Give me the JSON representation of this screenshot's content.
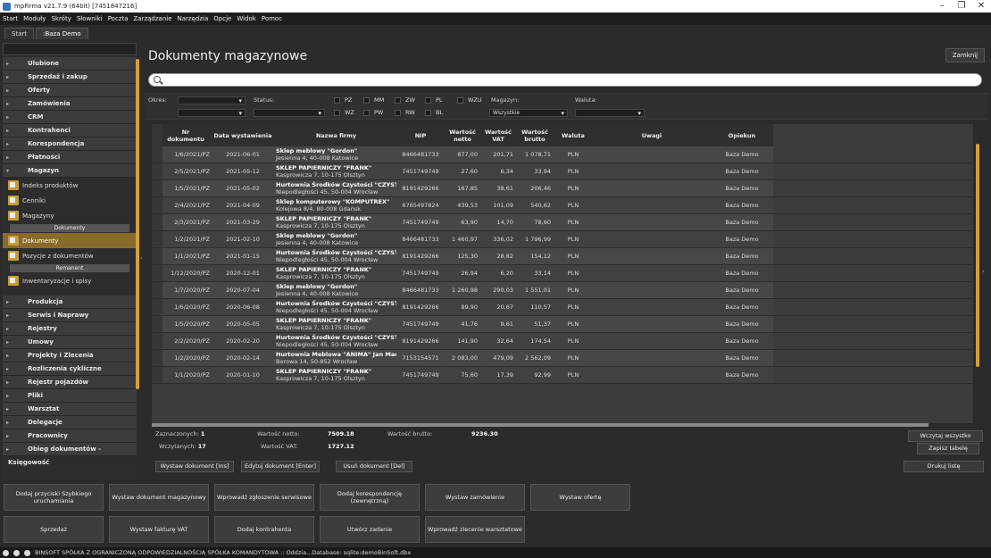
{
  "window": {
    "title": "mpFirma v21.7.9 (64bit) [7451847216]"
  },
  "menu": [
    "Start",
    "Moduły",
    "Skróty",
    "Słowniki",
    "Poczta",
    "Zarządzanie",
    "Narzędzia",
    "Opcje",
    "Widok",
    "Pomoc"
  ],
  "tabs": [
    "Start",
    ":Baza Demo"
  ],
  "sidebar": {
    "top_categories": [
      "Ulubione",
      "Sprzedaż i zakup",
      "Oferty",
      "Zamówienia",
      "CRM",
      "Kontrahenci",
      "Korespondencja",
      "Płatności",
      "Magazyn"
    ],
    "magazyn_items": {
      "indeks": "Indeks produktów",
      "cenniki": "Cenniki",
      "magazyny": "Magazyny",
      "hdr_dokumenty": "Dokumenty",
      "dokumenty": "Dokumenty",
      "pozycje": "Pozycje z dokumentów",
      "hdr_remanent": "Remanent",
      "inwent": "Inwentaryzacje i spisy"
    },
    "bottom_categories": [
      "Produkcja",
      "Serwis i Naprawy",
      "Rejestry",
      "Umowy",
      "Projekty i Zlecenia",
      "Rozliczenia cykliczne",
      "Rejestr pojazdów",
      "Pliki",
      "Warsztat",
      "Delegacje",
      "Pracownicy",
      "Obieg dokumentów - Księgowość"
    ]
  },
  "main": {
    "title": "Dokumenty magazynowe",
    "close": "Zamknij"
  },
  "filters": {
    "okres": "Okres:",
    "status": "Status:",
    "magazyn": "Magazyn:",
    "magazyn_value": "Wszystkie",
    "waluta": "Waluta:",
    "types_row1": [
      "PZ",
      "MM",
      "ZW",
      "PL",
      "WZU"
    ],
    "types_row2": [
      "WZ",
      "PW",
      "RW",
      "BL"
    ]
  },
  "table": {
    "headers": {
      "nr": "Nr dokumentu",
      "data": "Data wystawienia",
      "firma": "Nazwa firmy",
      "nip": "NIP",
      "netto": "Wartość netto",
      "vat": "Wartość VAT",
      "brutto": "Wartość brutto",
      "waluta": "Waluta",
      "uwagi": "Uwagi",
      "opiekun": "Opiekun"
    },
    "rows": [
      {
        "nr": "1/6/2021/PZ",
        "data": "2021-06-01",
        "firma": "Sklep meblowy \"Gordon\"",
        "adres": "Jesienna 4, 40-008 Katowice",
        "nip": "8466481733",
        "netto": "877,00",
        "vat": "201,71",
        "brutto": "1 078,71",
        "waluta": "PLN",
        "opiekun": "Baza Demo"
      },
      {
        "nr": "2/5/2021/PZ",
        "data": "2021-05-12",
        "firma": "SKLEP PAPIERNICZY \"FRANK\"",
        "adres": "Kasprowicza 7, 10-175 Olsztyn",
        "nip": "7451749749",
        "netto": "27,60",
        "vat": "6,34",
        "brutto": "33,94",
        "waluta": "PLN",
        "opiekun": "Baza Demo"
      },
      {
        "nr": "1/5/2021/PZ",
        "data": "2021-05-02",
        "firma": "Hurtownia Środków Czystości \"CZYSTEK\"",
        "adres": "Niepodległości 45, 50-004 Wrocław",
        "nip": "8191429266",
        "netto": "167,85",
        "vat": "38,61",
        "brutto": "206,46",
        "waluta": "PLN",
        "opiekun": "Baza Demo"
      },
      {
        "nr": "2/4/2021/PZ",
        "data": "2021-04-09",
        "firma": "Sklep komputerowy \"KOMPUTREX\"",
        "adres": "Kolejowa 8/4, 80-008 Gdańsk",
        "nip": "6765497824",
        "netto": "439,53",
        "vat": "101,09",
        "brutto": "540,62",
        "waluta": "PLN",
        "opiekun": "Baza Demo"
      },
      {
        "nr": "2/3/2021/PZ",
        "data": "2021-03-29",
        "firma": "SKLEP PAPIERNICZY \"FRANK\"",
        "adres": "Kasprowicza 7, 10-175 Olsztyn",
        "nip": "7451749749",
        "netto": "63,90",
        "vat": "14,70",
        "brutto": "78,60",
        "waluta": "PLN",
        "opiekun": "Baza Demo"
      },
      {
        "nr": "1/2/2021/PZ",
        "data": "2021-02-10",
        "firma": "Sklep meblowy \"Gordon\"",
        "adres": "Jesienna 4, 40-008 Katowice",
        "nip": "8466481733",
        "netto": "1 460,97",
        "vat": "336,02",
        "brutto": "1 796,99",
        "waluta": "PLN",
        "opiekun": "Baza Demo"
      },
      {
        "nr": "1/1/2021/PZ",
        "data": "2021-01-15",
        "firma": "Hurtownia Środków Czystości \"CZYSTEK\"",
        "adres": "Niepodległości 45, 50-004 Wrocław",
        "nip": "8191429266",
        "netto": "125,30",
        "vat": "28,82",
        "brutto": "154,12",
        "waluta": "PLN",
        "opiekun": "Baza Demo"
      },
      {
        "nr": "1/12/2020/PZ",
        "data": "2020-12-01",
        "firma": "SKLEP PAPIERNICZY \"FRANK\"",
        "adres": "Kasprowicza 7, 10-175 Olsztyn",
        "nip": "7451749749",
        "netto": "26,94",
        "vat": "6,20",
        "brutto": "33,14",
        "waluta": "PLN",
        "opiekun": "Baza Demo"
      },
      {
        "nr": "1/7/2020/PZ",
        "data": "2020-07-04",
        "firma": "Sklep meblowy \"Gordon\"",
        "adres": "Jesienna 4, 40-008 Katowice",
        "nip": "8466481733",
        "netto": "1 260,98",
        "vat": "290,03",
        "brutto": "1 551,01",
        "waluta": "PLN",
        "opiekun": "Baza Demo"
      },
      {
        "nr": "1/6/2020/PZ",
        "data": "2020-06-08",
        "firma": "Hurtownia Środków Czystości \"CZYSTEK\"",
        "adres": "Niepodległości 45, 50-004 Wrocław",
        "nip": "8191429266",
        "netto": "89,90",
        "vat": "20,67",
        "brutto": "110,57",
        "waluta": "PLN",
        "opiekun": "Baza Demo"
      },
      {
        "nr": "1/5/2020/PZ",
        "data": "2020-05-05",
        "firma": "SKLEP PAPIERNICZY \"FRANK\"",
        "adres": "Kasprowicza 7, 10-175 Olsztyn",
        "nip": "7451749749",
        "netto": "41,76",
        "vat": "9,61",
        "brutto": "51,37",
        "waluta": "PLN",
        "opiekun": "Baza Demo"
      },
      {
        "nr": "2/2/2020/PZ",
        "data": "2020-02-20",
        "firma": "Hurtownia Środków Czystości \"CZYSTEK\"",
        "adres": "Niepodległości 45, 50-004 Wrocław",
        "nip": "8191429266",
        "netto": "141,90",
        "vat": "32,64",
        "brutto": "174,54",
        "waluta": "PLN",
        "opiekun": "Baza Demo"
      },
      {
        "nr": "1/2/2020/PZ",
        "data": "2020-02-14",
        "firma": "Hurtownia Meblowa \"ANIMA\" Jan Macioch",
        "adres": "Borowa 14, 50-852 Wrocław",
        "nip": "7153154571",
        "netto": "2 083,00",
        "vat": "479,09",
        "brutto": "2 562,09",
        "waluta": "PLN",
        "opiekun": "Baza Demo"
      },
      {
        "nr": "1/1/2020/PZ",
        "data": "2020-01-10",
        "firma": "SKLEP PAPIERNICZY \"FRANK\"",
        "adres": "Kasprowicza 7, 10-175 Olsztyn",
        "nip": "7451749749",
        "netto": "75,60",
        "vat": "17,39",
        "brutto": "92,99",
        "waluta": "PLN",
        "opiekun": "Baza Demo"
      }
    ]
  },
  "summary": {
    "zaznaczonych_label": "Zaznaczonych:",
    "zaznaczonych": "1",
    "wczytanych_label": "Wczytanych:",
    "wczytanych": "17",
    "netto_label": "Wartość netto:",
    "netto": "7509.18",
    "vat_label": "Wartość VAT:",
    "vat": "1727.12",
    "brutto_label": "Wartość brutto:",
    "brutto": "9236.30",
    "wczytaj": "Wczytaj wszystko",
    "zapisz": "Zapisz tabelę",
    "drukuj": "Drukuj listę",
    "wystaw": "Wystaw dokument [Ins]",
    "edytuj": "Edytuj dokument [Enter]",
    "usun": "Usuń dokument [Del]"
  },
  "quick": {
    "dodaj_przyciski": "Dodaj przyciski Szybkiego uruchamiania",
    "wystaw_mag": "Wystaw dokument magazynowy",
    "zgloszenie": "Wprowadź zgłoszenie serwisowe",
    "koresp": "Dodaj korespondencję (zewnętrzną)",
    "zamowienie": "Wystaw zamówienie",
    "oferta": "Wystaw ofertę",
    "sprzedaz": "Sprzedaż",
    "faktura": "Wystaw fakturę VAT",
    "kontrahent": "Dodaj kontrahenta",
    "zadanie": "Utwórz zadanie",
    "warsztat": "Wprowadź zlecenie warsztatowe"
  },
  "status": {
    "text": "BINSOFT SPÓŁKA Z OGRANICZONĄ ODPOWIEDZIALNOŚCIĄ SPÓŁKA KOMANDYTOWA :: Oddzia...Database: sqlite:demoBinSoft.dbx"
  }
}
